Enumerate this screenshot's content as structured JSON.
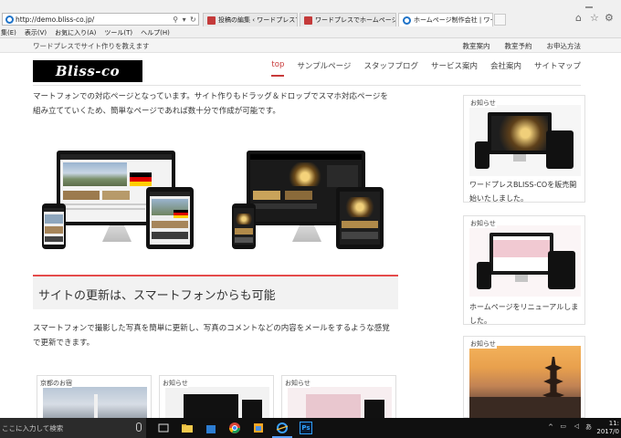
{
  "browser": {
    "address": "http://demo.bliss-co.jp/",
    "tabs": [
      "投稿の編集 ‹ ワードプレスでホーム...",
      "ワードプレスでホームページ作成 ‧ ブ...",
      "ホームページ制作会社 | ワードプ..."
    ],
    "tab_close": "×",
    "menu": [
      "ファイル(F)",
      "編集(E)",
      "表示(V)",
      "お気に入り(A)",
      "ツール(T)",
      "ヘルプ(H)"
    ],
    "menu_visible": [
      "集(E)",
      "表示(V)",
      "お気に入り(A)",
      "ツール(T)",
      "ヘルプ(H)"
    ]
  },
  "site": {
    "tagline": "ワードプレスでサイト作りを教えます",
    "top_links": [
      "教室案内",
      "教室予約",
      "お申込方法"
    ],
    "logo": "Bliss-co",
    "nav": [
      "top",
      "サンプルページ",
      "スタッフブログ",
      "サービス案内",
      "会社案内",
      "サイトマップ"
    ],
    "nav_active": "top"
  },
  "main": {
    "intro_line1": "マートフォンでの対応ページとなっています。サイト作りもドラッグ＆ドロップでスマホ対応ページを",
    "intro_line2": "組み立てていくため、簡単なページであれば数十分で作成が可能です。",
    "section_title": "サイトの更新は、スマートフォンからも可能",
    "body_line1": "スマートフォンで撮影した写真を簡単に更新し、写真のコメントなどの内容をメールをするような感覚",
    "body_line2": "で更新できます。",
    "cards": [
      "京都のお宿",
      "お知らせ",
      "お知らせ"
    ]
  },
  "sidebar": {
    "cards": [
      {
        "label": "お知らせ",
        "caption": "ワードプレスBLISS-COを販売開始いたしました。"
      },
      {
        "label": "お知らせ",
        "caption": "ホームページをリニューアルしました。"
      },
      {
        "label": "お知らせ",
        "caption": ""
      }
    ]
  },
  "taskbar": {
    "search_placeholder": "ここに入力して検索",
    "clock_time": "11:",
    "clock_date": "2017/0",
    "ps_label": "Ps"
  },
  "colors": {
    "accent": "#c83a3a",
    "section_rule": "#e54b4b",
    "logo_bg": "#000000",
    "taskbar": "#101010"
  }
}
